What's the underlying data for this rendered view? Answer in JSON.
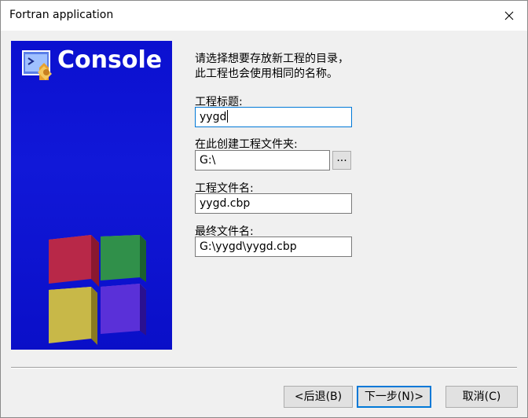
{
  "window": {
    "title": "Fortran application"
  },
  "banner": {
    "title": "Console"
  },
  "instructions": {
    "line1": "请选择想要存放新工程的目录，",
    "line2": "此工程也会使用相同的名称。"
  },
  "form": {
    "project_title_label": "工程标题:",
    "project_title_value": "yygd",
    "folder_label": "在此创建工程文件夹:",
    "folder_value": "G:\\",
    "browse_label": "...",
    "project_filename_label": "工程文件名:",
    "project_filename_value": "yygd.cbp",
    "final_filename_label": "最终文件名:",
    "final_filename_value": "G:\\yygd\\yygd.cbp"
  },
  "buttons": {
    "back": "<后退(B)",
    "next": "下一步(N)>",
    "cancel": "取消(C)"
  },
  "colors": {
    "banner_blue": "#0b10d0",
    "focus_blue": "#0078d7"
  }
}
